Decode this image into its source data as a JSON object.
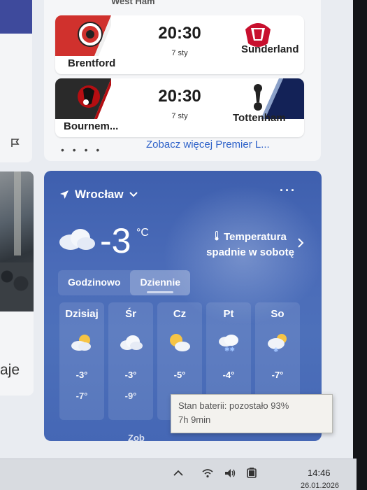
{
  "colors": {
    "accent_link": "#2e62c9",
    "weather_bg": "#4567b5",
    "brentford_red": "#d0312d",
    "sunderland_red": "#c8102e",
    "bournemouth_red": "#b50e12",
    "tottenham_navy": "#132257"
  },
  "left": {
    "text_fragment": "aje"
  },
  "sports": {
    "top_partial": "West Ham",
    "matches": [
      {
        "home": "Brentford",
        "away": "Sunderland",
        "time": "20:30",
        "date": "7 sty"
      },
      {
        "home": "Bournem...",
        "away": "Tottenham",
        "time": "20:30",
        "date": "7 sty"
      }
    ],
    "dots": "• • • •",
    "see_more": "Zobacz więcej Premier L..."
  },
  "weather": {
    "location": "Wrocław",
    "more": "···",
    "temperature": "-3",
    "unit": "°C",
    "note": "Temperatura spadnie w sobotę",
    "tabs": [
      "Godzinowo",
      "Dziennie"
    ],
    "active_tab": "Dziennie",
    "days": [
      {
        "name": "Dzisiaj",
        "icon": "partly-cloudy-icon",
        "hi": "-3°",
        "lo": "-7°"
      },
      {
        "name": "Śr",
        "icon": "cloudy-icon",
        "hi": "-3°",
        "lo": "-9°"
      },
      {
        "name": "Cz",
        "icon": "sun-cloud-icon",
        "hi": "-5°",
        "lo": ""
      },
      {
        "name": "Pt",
        "icon": "snow-cloud-icon",
        "hi": "-4°",
        "lo": ""
      },
      {
        "name": "So",
        "icon": "snow-sun-icon",
        "hi": "-7°",
        "lo": ""
      }
    ],
    "bottom_partial": "Zob"
  },
  "tooltip": {
    "line1": "Stan baterii: pozostało 93%",
    "line2": "7h 9min"
  },
  "taskbar": {
    "time": "14:46",
    "date_partial": "26.01.2026"
  }
}
